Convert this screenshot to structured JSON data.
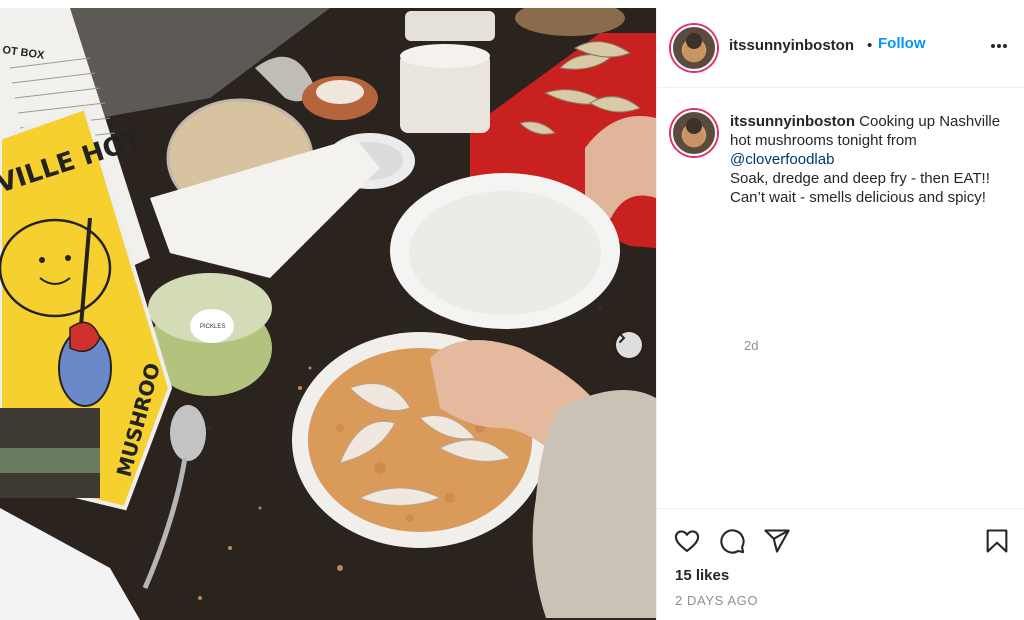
{
  "post": {
    "username": "itssunnyinboston",
    "separator": "•",
    "follow_label": "Follow",
    "more_icon": "more-options-icon",
    "caption": {
      "username": "itssunnyinboston",
      "text_before_mention": " Cooking up Nashville hot mushrooms tonight from ",
      "mention": "@cloverfoodlab",
      "text_after_mention": "Soak, dredge and deep fry - then EAT!! Can’t wait - smells delicious and spicy!"
    },
    "time_short": "2d",
    "likes": "15 likes",
    "timestamp": "2 DAYS AGO",
    "actions": {
      "like_icon": "heart-icon",
      "comment_icon": "comment-icon",
      "share_icon": "share-icon",
      "save_icon": "bookmark-icon"
    },
    "photo": {
      "poster_text_top": "VILLE HOT",
      "poster_text_side": "MUSHROO",
      "pickles_label": "PICKLES",
      "doc_heading": "OT BOX"
    }
  },
  "colors": {
    "accent_blue": "#0095f6",
    "mention_blue": "#00376b",
    "muted_text": "#8e8e8e",
    "story_ring": "#e1306c"
  }
}
